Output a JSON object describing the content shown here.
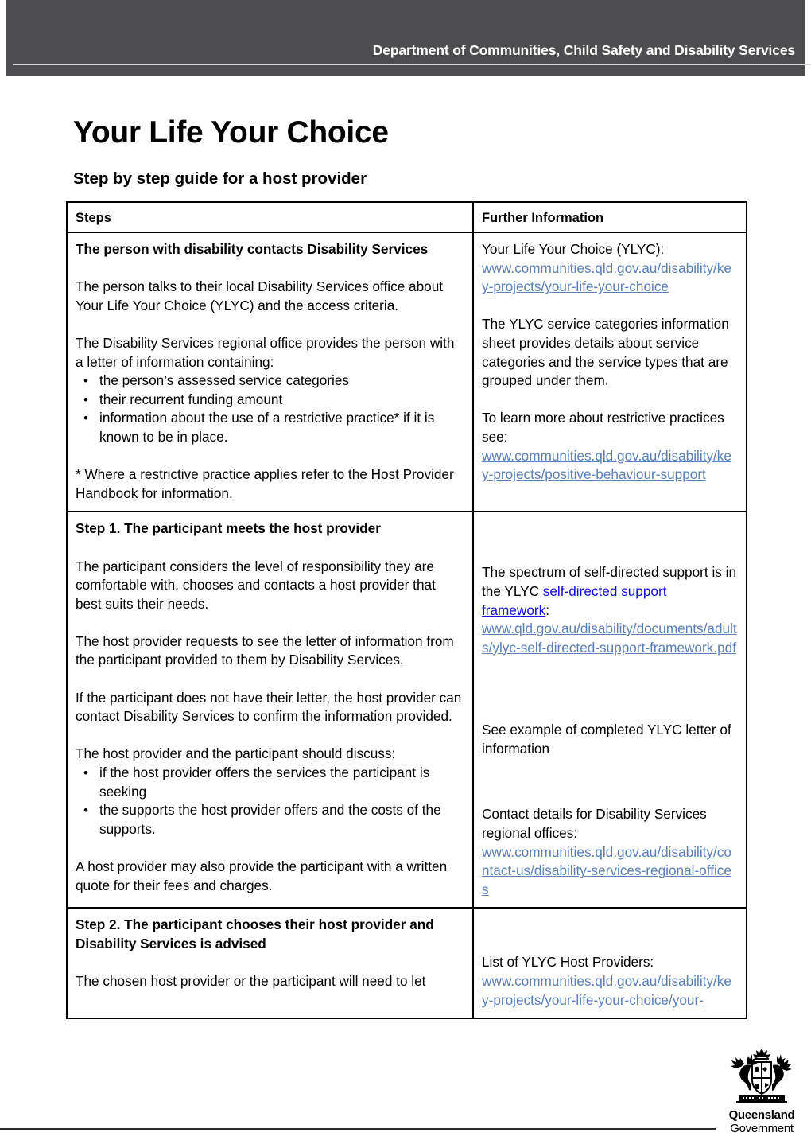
{
  "header": {
    "department": "Department of Communities, Child Safety and Disability Services"
  },
  "title": "Your Life Your Choice",
  "subtitle": "Step by step guide for a host provider",
  "table": {
    "columns": [
      "Steps",
      "Further Information"
    ],
    "rows": [
      {
        "steps": {
          "heading": "The person with disability contacts Disability Services",
          "para1": "The person talks to their local Disability Services office about Your Life Your Choice (YLYC) and the access criteria.",
          "para2": "The Disability Services regional office provides the person with a letter of information containing:",
          "bullets": [
            "the person’s assessed service categories",
            "their recurrent funding amount",
            "information about the use of a restrictive practice* if it is known to be in place."
          ],
          "footnote": "* Where a restrictive practice applies refer to the Host Provider Handbook for information."
        },
        "info": {
          "lead1": "Your Life Your Choice (YLYC):",
          "link1": "www.communities.qld.gov.au/disability/key-projects/your-life-your-choice",
          "para2": "The YLYC service categories information sheet provides details about service categories and the service types that are grouped under them.",
          "lead3": "To learn more about restrictive practices see:",
          "link3": "www.communities.qld.gov.au/disability/key-projects/positive-behaviour-support"
        }
      },
      {
        "steps": {
          "heading": "Step 1. The participant meets the host provider",
          "para1": "The participant considers the level of responsibility they are comfortable with, chooses and contacts a host provider that best suits their needs.",
          "para2": "The host provider requests to see the letter of information from the participant provided to them by Disability Services.",
          "para3": "If the participant does not have their letter, the host provider can contact Disability Services to confirm the information provided.",
          "para4": "The host provider and the participant should discuss:",
          "bullets": [
            "if the host provider offers the services the participant is seeking",
            "the supports the host provider offers and the costs of the supports."
          ],
          "para5": "A host provider may also provide the participant with a written quote for their fees and charges."
        },
        "info": {
          "para1_a": "The spectrum of self-directed support is in the YLYC ",
          "para1_link": "self-directed support framework",
          "para1_b": ":",
          "link1": "www.qld.gov.au/disability/documents/adults/ylyc-self-directed-support-framework.pdf",
          "para2": "See example of completed YLYC letter of information",
          "lead3": "Contact details for Disability Services regional offices:",
          "link3": "www.communities.qld.gov.au/disability/contact-us/disability-services-regional-offices"
        }
      },
      {
        "steps": {
          "heading": "Step 2. The participant chooses their host provider and Disability Services is advised",
          "para1": "The chosen host provider or the participant will need to let"
        },
        "info": {
          "lead1": "List of YLYC Host Providers:",
          "link1": "www.communities.qld.gov.au/disability/key-projects/your-life-your-choice/your-"
        }
      }
    ]
  },
  "footer": {
    "logo_line1": "Queensland",
    "logo_line2": "Government"
  },
  "colors": {
    "header_band": "#4d4d4f",
    "link_plain": "#5a7fb5",
    "link_strong": "#1111dd"
  }
}
